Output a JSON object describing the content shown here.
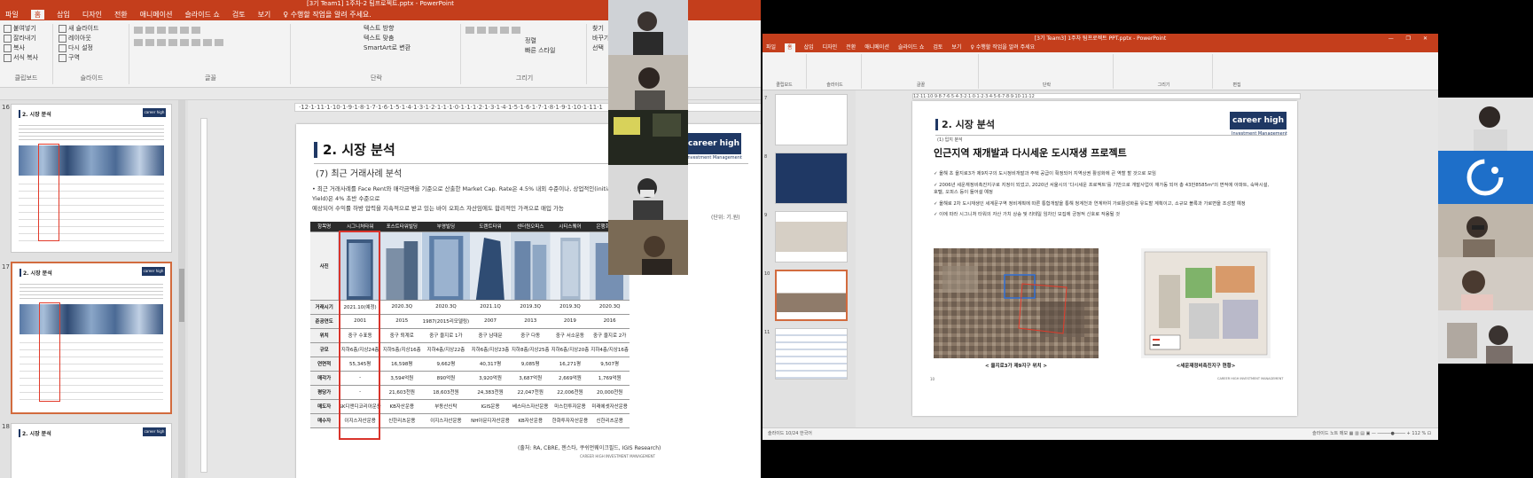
{
  "left": {
    "title_bar": "[3기 Team1] 1주차-2 팀프로젝트.pptx - PowerPoint",
    "menu": [
      "파일",
      "홈",
      "삽입",
      "디자인",
      "전환",
      "애니메이션",
      "슬라이드 쇼",
      "검토",
      "보기",
      "♀ 수행할 작업을 알려 주세요."
    ],
    "ribbon_groups": [
      {
        "label": "클립보드",
        "items": [
          "붙여넣기",
          "잘라내기",
          "복사",
          "서식 복사"
        ]
      },
      {
        "label": "슬라이드",
        "items": [
          "새 슬라이드",
          "레이아웃",
          "다시 설정",
          "구역"
        ]
      },
      {
        "label": "글꼴",
        "items": []
      },
      {
        "label": "단락",
        "items": [
          "텍스트 방향",
          "텍스트 맞춤",
          "SmartArt로 변환"
        ]
      },
      {
        "label": "그리기",
        "items": [
          "정렬",
          "빠른 스타일"
        ]
      },
      {
        "label": "편집",
        "items": [
          "찾기",
          "바꾸기",
          "선택"
        ]
      }
    ],
    "thumb_numbers": [
      "16",
      "17",
      "18"
    ],
    "ruler": "·12·1·11·1·10·1·9·1·8·1·7·1·6·1·5·1·4·1·3·1·2·1·1·1·0·1·1·1·2·1·3·1·4·1·5·1·6·1·7·1·8·1·9·1·10·1·11·1",
    "slide": {
      "section_title": "2. 시장 분석",
      "logo": "career high",
      "logo_sub": "Investment Management",
      "subtitle": "(7) 최근 거래사례 분석",
      "bullet_1": "• 최근 거래사례를 Face Rent와 매각금액을 기준으로 산출한 Market Cap. Rate은 4.5% 내외 수준이나, 상업적인(initial NOI Yield)은 4% 초반 수준으로",
      "bullet_2": "예상되어 수익률 하방 압력을 지속적으로 받고 있는 바이 오피스 자산임에도 합리적인 가격으로 매입 가능",
      "unit": "(단위: 기.원)",
      "table_headers": [
        "항목명",
        "시그니처타워",
        "포스트타워빌딩",
        "부영빌딩",
        "도렌트타워",
        "센터원오피스",
        "시티스퀘어",
        "은행회관빌딩"
      ],
      "table_rows": [
        {
          "head": "사진",
          "cells": []
        },
        {
          "head": "거래시기",
          "cells": [
            "2021.10(예정)",
            "2020.3Q",
            "2020.3Q",
            "2021.1Q",
            "2019.3Q",
            "2019.3Q",
            "2020.3Q"
          ]
        },
        {
          "head": "준공연도",
          "cells": [
            "2001",
            "2015",
            "1987(2015리모델링)",
            "2007",
            "2013",
            "2019",
            "2016"
          ]
        },
        {
          "head": "위치",
          "cells": [
            "중구 수표동",
            "중구 퇴계로",
            "중구 을지로 1가",
            "중구 남대문",
            "중구 다동",
            "중구 서소문동",
            "중구 을지로 2가"
          ]
        },
        {
          "head": "규모",
          "cells": [
            "지하6층/지상24층",
            "지하5층/지상16층",
            "지하4층/지상22층",
            "지하6층/지상23층",
            "지하8층/지상25층",
            "지하6층/지상20층",
            "지하4층/지상16층"
          ]
        },
        {
          "head": "연면적",
          "cells": [
            "55,345평",
            "16,598평",
            "9,662평",
            "40,317평",
            "9,085평",
            "16,271평",
            "9,507평"
          ]
        },
        {
          "head": "매각가",
          "cells": [
            "-",
            "3,594억원",
            "890억원",
            "3,920억원",
            "3,687억원",
            "2,669억원",
            "1,769억원"
          ]
        },
        {
          "head": "평당가",
          "cells": [
            "-",
            "21,603천원",
            "18,603천원",
            "24,383천원",
            "22,047천원",
            "22,006천원",
            "20,000천원"
          ]
        },
        {
          "head": "매도자",
          "cells": [
            "SK디앤디코리아운용",
            "KB자산운용",
            "부동산신탁",
            "IGIS운용",
            "베스타스자산운용",
            "마스턴투자운용",
            "미래에셋자산운용"
          ]
        },
        {
          "head": "매수자",
          "cells": [
            "이지스자산운용",
            "신한리츠운용",
            "이지스자산운용",
            "NH아문디자산운용",
            "KB자산운용",
            "한화투자자산운용",
            "신한리츠운용"
          ]
        }
      ],
      "source": "(출처: RA, CBRE, 젠스타, 쿠쉬먼웨이크필드, IGIS Research)",
      "footer": "CAREER HIGH INVESTMENT MANAGEMENT"
    }
  },
  "right": {
    "title_bar": "[3기 Team3] 1주차 팀프로젝트 PPT.pptx - PowerPoint",
    "window_buttons": "— ❐ ✕",
    "menu": [
      "파일",
      "홈",
      "삽입",
      "디자인",
      "전환",
      "애니메이션",
      "슬라이드 쇼",
      "검토",
      "보기",
      "♀ 수행할 작업을 알려 주세요"
    ],
    "ribbon_groups": [
      "클립보드",
      "슬라이드",
      "글꼴",
      "단락",
      "그리기",
      "편집"
    ],
    "thumb_numbers": [
      "7",
      "8",
      "9",
      "10",
      "11"
    ],
    "ruler": "12·11·10·9·8·7·6·5·4·3·2·1·0·1·2·3·4·5·6·7·8·9·10·11·12",
    "slide": {
      "section_title": "2. 시장 분석",
      "logo": "career high",
      "logo_sub": "Investment Management",
      "sub": "(1) 입지 분석",
      "heading": "인근지역 재개발과 다시세운 도시재생 프로젝트",
      "bullets": [
        "✓ 올해 초 을지로3가 제9지구의 도시정비개발과 주택 공급이 확정되어 지역상권 활성화에 큰 역할 할 것으로 보임",
        "✓ 2006년 세운재정비촉진지구로 지정이 되었고, 2020년 서울시의 '다시세운 프로젝트'를 기반으로 개발사업이 재가동 되어 총 43만8585m²의 면적에 아파트, 숙박시설, 호텔, 오피스 등이 들어설 예정",
        "✓ 올해로 2차 도시재생인 세계문구역 정비계획에 따른 통합개발을 통해 청계천과 연계하여 가로활성화를 유도할 계획이고, 소규모 블록과 가로변을 조성할 예정",
        "✓ 이에 따라 시그니처 타워의 자산 가치 상승 및 리테일 임차인 모집에 긍정적 신호로 작용될 것"
      ],
      "caption_1": "< 을지로3가 제9지구 위치 >",
      "caption_2": "<세운재정비촉진지구 현황>",
      "footer": "CAREER HIGH INVESTMENT MANAGEMENT",
      "page_num": "10"
    },
    "status_left": "슬라이드 10/24   한국어",
    "status_right": "슬라이드 노트   메모   ▦  ▥  ▤  ▣   — ─────●──── +  112 %  ⊡"
  }
}
